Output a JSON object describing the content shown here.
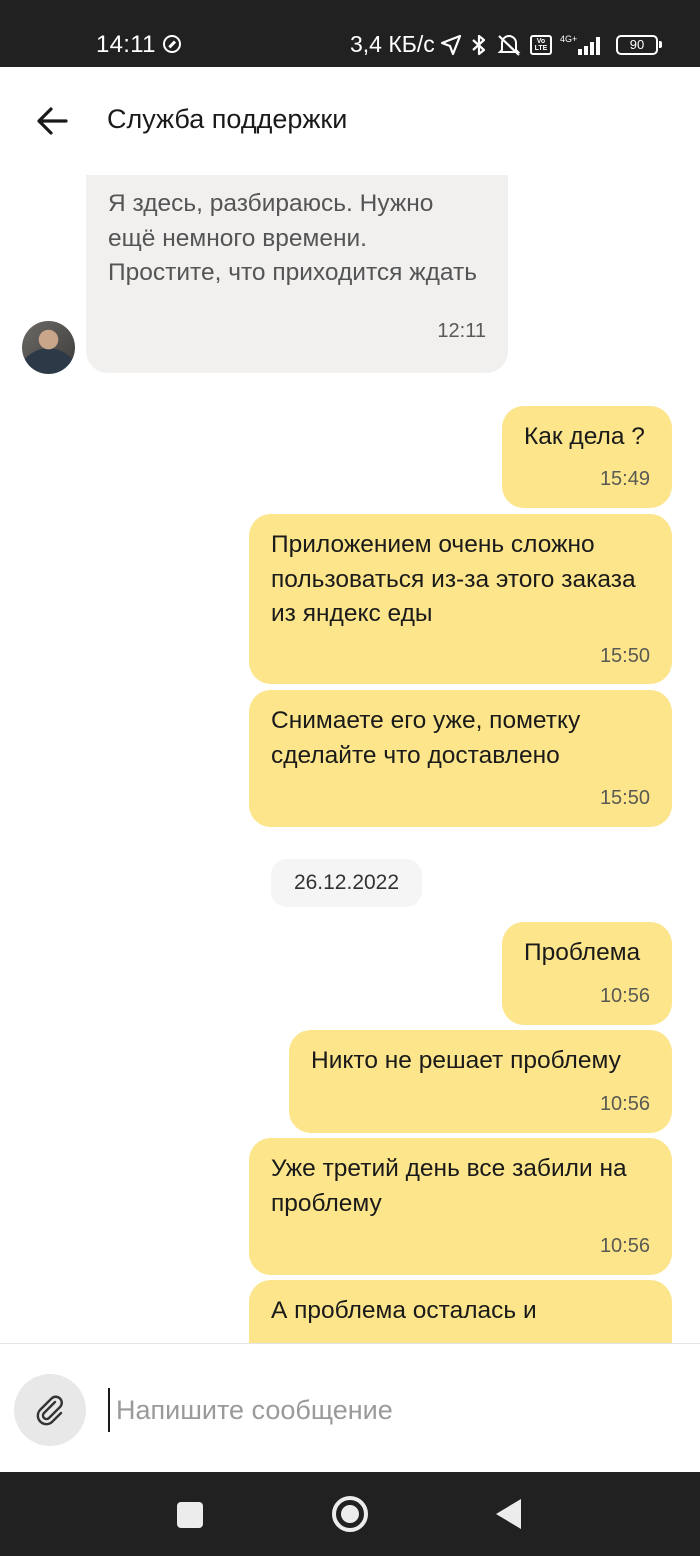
{
  "status_bar": {
    "time": "14:11",
    "network_speed": "3,4 КБ/с",
    "network_type": "4G+",
    "volte_label": "Vo LTE",
    "battery": "90",
    "icons": [
      "vpn-shield-icon",
      "location-arrow-icon",
      "bluetooth-icon",
      "muted-alarm-icon",
      "volte-icon",
      "signal-icon",
      "battery-icon"
    ]
  },
  "header": {
    "title": "Служба поддержки",
    "back_icon": "arrow-left-icon"
  },
  "messages": [
    {
      "direction": "incoming",
      "text": "Я здесь, разбираюсь. Нужно ещё немного времени. Простите, что приходится ждать",
      "time": "12:11"
    },
    {
      "direction": "outgoing",
      "text": "Как дела ?",
      "time": "15:49"
    },
    {
      "direction": "outgoing",
      "text": "Приложением очень сложно пользоваться из-за этого заказа из яндекс еды",
      "time": "15:50"
    },
    {
      "direction": "outgoing",
      "text": "Снимаете его уже, пометку сделайте что доставлено",
      "time": "15:50"
    },
    {
      "direction": "outgoing",
      "text": "Проблема",
      "time": "10:56"
    },
    {
      "direction": "outgoing",
      "text": "Никто не решает проблему",
      "time": "10:56"
    },
    {
      "direction": "outgoing",
      "text": "Уже третий день все забили на проблему",
      "time": "10:56"
    },
    {
      "direction": "outgoing",
      "text": "А проблема осталась и",
      "time": ""
    }
  ],
  "date_separator": "26.12.2022",
  "composer": {
    "placeholder": "Напишите сообщение",
    "value": "",
    "attach_icon": "paperclip-icon"
  },
  "nav_bar": {
    "icons": [
      "recents-square-icon",
      "home-circle-icon",
      "back-triangle-icon"
    ]
  },
  "colors": {
    "outgoing_bubble": "#fce58a",
    "incoming_bubble": "#f1f0ef",
    "system_bars": "#212121"
  }
}
